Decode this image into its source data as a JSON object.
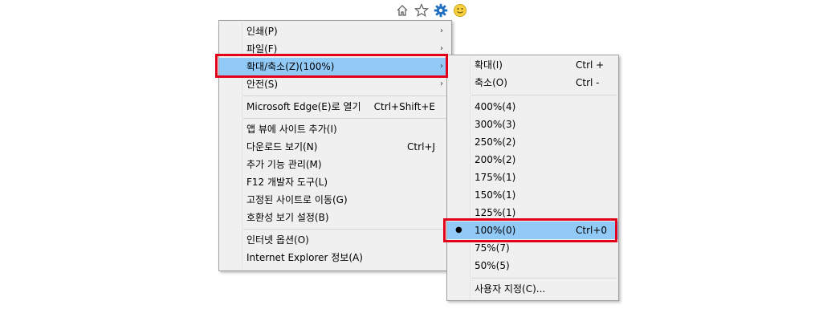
{
  "toolbar": {
    "icons": [
      "home-icon",
      "star-icon",
      "gear-icon",
      "smiley-icon"
    ]
  },
  "main_menu": {
    "items": [
      {
        "label": "인쇄(P)",
        "shortcut": "",
        "arrow": "›"
      },
      {
        "label": "파일(F)",
        "shortcut": "",
        "arrow": "›"
      },
      {
        "label": "확대/축소(Z)(100%)",
        "shortcut": "",
        "arrow": "›"
      },
      {
        "label": "안전(S)",
        "shortcut": "",
        "arrow": "›"
      },
      {
        "label": "Microsoft Edge(E)로 열기",
        "shortcut": "Ctrl+Shift+E",
        "arrow": ""
      },
      {
        "label": "앱 뷰에 사이트 추가(I)",
        "shortcut": "",
        "arrow": ""
      },
      {
        "label": "다운로드 보기(N)",
        "shortcut": "Ctrl+J",
        "arrow": ""
      },
      {
        "label": "추가 기능 관리(M)",
        "shortcut": "",
        "arrow": ""
      },
      {
        "label": "F12 개발자 도구(L)",
        "shortcut": "",
        "arrow": ""
      },
      {
        "label": "고정된 사이트로 이동(G)",
        "shortcut": "",
        "arrow": ""
      },
      {
        "label": "호환성 보기 설정(B)",
        "shortcut": "",
        "arrow": ""
      },
      {
        "label": "인터넷 옵션(O)",
        "shortcut": "",
        "arrow": ""
      },
      {
        "label": "Internet Explorer 정보(A)",
        "shortcut": "",
        "arrow": ""
      }
    ]
  },
  "zoom_menu": {
    "items": [
      {
        "label": "확대(I)",
        "shortcut": "Ctrl +"
      },
      {
        "label": "축소(O)",
        "shortcut": "Ctrl -"
      },
      {
        "label": "400%(4)",
        "shortcut": ""
      },
      {
        "label": "300%(3)",
        "shortcut": ""
      },
      {
        "label": "250%(2)",
        "shortcut": ""
      },
      {
        "label": "200%(2)",
        "shortcut": ""
      },
      {
        "label": "175%(1)",
        "shortcut": ""
      },
      {
        "label": "150%(1)",
        "shortcut": ""
      },
      {
        "label": "125%(1)",
        "shortcut": ""
      },
      {
        "label": "100%(0)",
        "shortcut": "Ctrl+0",
        "bullet": "●"
      },
      {
        "label": "75%(7)",
        "shortcut": ""
      },
      {
        "label": "50%(5)",
        "shortcut": ""
      },
      {
        "label": "사용자 지정(C)...",
        "shortcut": ""
      }
    ]
  },
  "colors": {
    "highlight": "#91c9f7",
    "annotation_red": "#e3001b",
    "gear_blue": "#1e6fc0"
  }
}
